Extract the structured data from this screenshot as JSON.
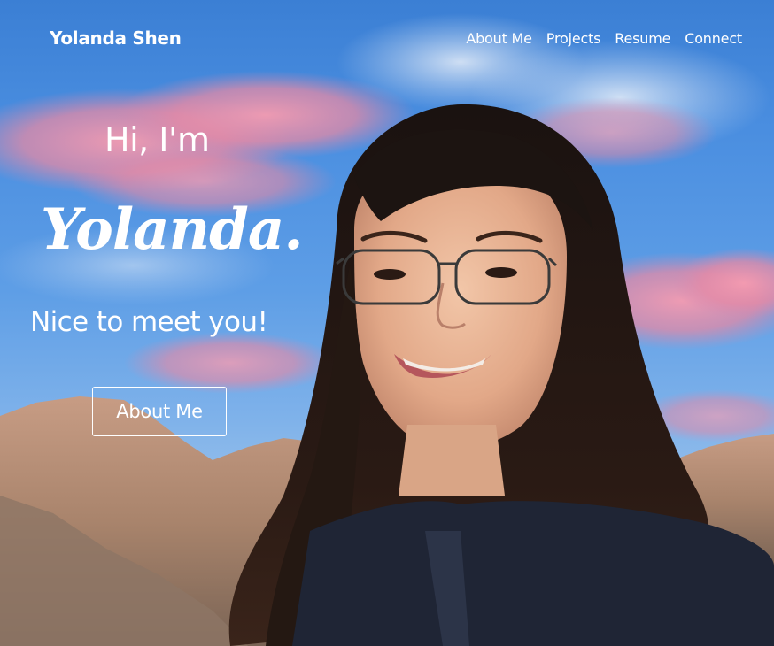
{
  "nav": {
    "brand": "Yolanda Shen",
    "links": [
      {
        "label": "About Me"
      },
      {
        "label": "Projects"
      },
      {
        "label": "Resume"
      },
      {
        "label": "Connect"
      }
    ]
  },
  "hero": {
    "greeting": "Hi, I'm",
    "name": "Yolanda.",
    "tagline": "Nice to meet you!",
    "cta_label": "About Me"
  },
  "colors": {
    "sky": "#4a8ee0",
    "cloud_pink": "#ef8fa8",
    "mountain": "#b8927a",
    "text": "#ffffff"
  }
}
